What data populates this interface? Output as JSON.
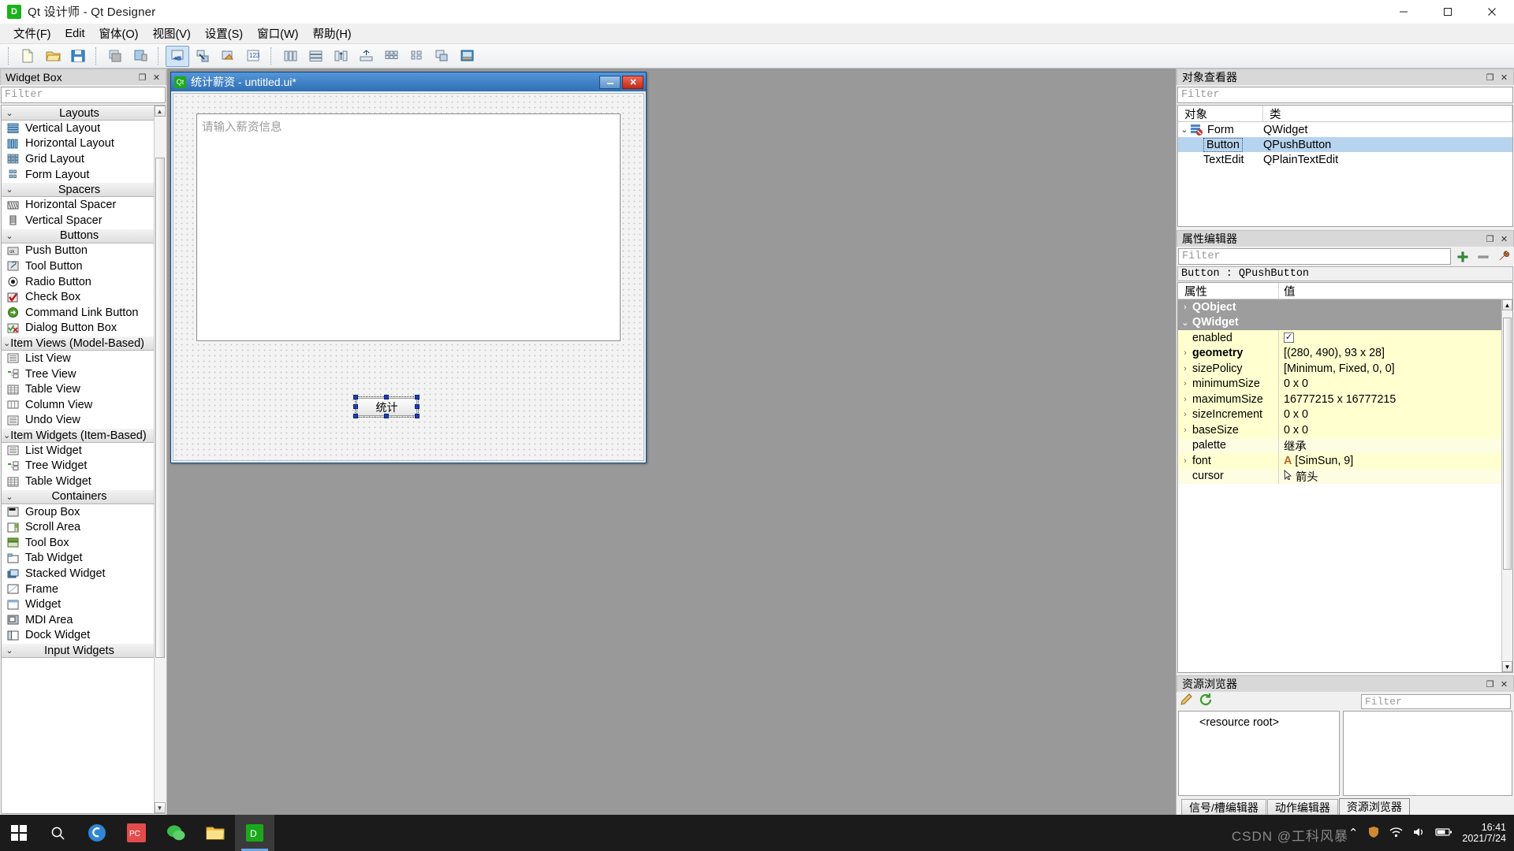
{
  "window": {
    "app_icon": "D",
    "title": "Qt 设计师 - Qt Designer",
    "minimize": "—",
    "maximize": "▢",
    "close": "✕"
  },
  "menubar": {
    "items": [
      {
        "label": "文件(F)"
      },
      {
        "label": "Edit"
      },
      {
        "label": "窗体(O)"
      },
      {
        "label": "视图(V)"
      },
      {
        "label": "设置(S)"
      },
      {
        "label": "窗口(W)"
      },
      {
        "label": "帮助(H)"
      }
    ]
  },
  "toolbar": {
    "groups": [
      {
        "buttons": [
          {
            "name": "new-form-button",
            "icon": "new-file-icon"
          },
          {
            "name": "open-form-button",
            "icon": "open-folder-icon"
          },
          {
            "name": "save-form-button",
            "icon": "save-disk-icon"
          }
        ]
      },
      {
        "buttons": [
          {
            "name": "undo-button",
            "icon": "undo-icon"
          },
          {
            "name": "redo-button",
            "icon": "redo-icon"
          }
        ]
      },
      {
        "buttons": [
          {
            "name": "edit-widgets-button",
            "icon": "edit-widgets-icon",
            "active": true
          },
          {
            "name": "edit-signals-slots-button",
            "icon": "signals-slots-icon"
          },
          {
            "name": "edit-buddies-button",
            "icon": "buddies-icon"
          },
          {
            "name": "edit-tab-order-button",
            "icon": "tab-order-icon"
          }
        ]
      },
      {
        "buttons": [
          {
            "name": "layout-horizontally-button",
            "icon": "layout-horizontal-icon"
          },
          {
            "name": "layout-vertically-button",
            "icon": "layout-vertical-icon"
          },
          {
            "name": "layout-splitter-horizontal-button",
            "icon": "splitter-h-icon"
          },
          {
            "name": "layout-splitter-vertical-button",
            "icon": "splitter-v-icon"
          },
          {
            "name": "layout-grid-button",
            "icon": "layout-grid-icon"
          },
          {
            "name": "layout-form-button",
            "icon": "layout-form-icon"
          },
          {
            "name": "break-layout-button",
            "icon": "break-layout-icon"
          },
          {
            "name": "adjust-size-button",
            "icon": "adjust-size-icon"
          }
        ]
      }
    ]
  },
  "widget_box": {
    "title": "Widget Box",
    "filter_placeholder": "Filter",
    "float_btn": "❐",
    "close_btn": "✕",
    "groups": [
      {
        "name": "Layouts",
        "chevron": "⌄",
        "items": [
          {
            "label": "Vertical Layout",
            "icon": "vertical-layout-icon"
          },
          {
            "label": "Horizontal Layout",
            "icon": "horizontal-layout-icon"
          },
          {
            "label": "Grid Layout",
            "icon": "grid-layout-icon"
          },
          {
            "label": "Form Layout",
            "icon": "form-layout-icon"
          }
        ]
      },
      {
        "name": "Spacers",
        "chevron": "⌄",
        "items": [
          {
            "label": "Horizontal Spacer",
            "icon": "horizontal-spacer-icon"
          },
          {
            "label": "Vertical Spacer",
            "icon": "vertical-spacer-icon"
          }
        ]
      },
      {
        "name": "Buttons",
        "chevron": "⌄",
        "items": [
          {
            "label": "Push Button",
            "icon": "push-button-icon"
          },
          {
            "label": "Tool Button",
            "icon": "tool-button-icon"
          },
          {
            "label": "Radio Button",
            "icon": "radio-button-icon"
          },
          {
            "label": "Check Box",
            "icon": "check-box-icon"
          },
          {
            "label": "Command Link Button",
            "icon": "command-link-icon"
          },
          {
            "label": "Dialog Button Box",
            "icon": "dialog-button-box-icon"
          }
        ]
      },
      {
        "name": "Item Views (Model-Based)",
        "chevron": "⌄",
        "items": [
          {
            "label": "List View",
            "icon": "list-view-icon"
          },
          {
            "label": "Tree View",
            "icon": "tree-view-icon"
          },
          {
            "label": "Table View",
            "icon": "table-view-icon"
          },
          {
            "label": "Column View",
            "icon": "column-view-icon"
          },
          {
            "label": "Undo View",
            "icon": "undo-view-icon"
          }
        ]
      },
      {
        "name": "Item Widgets (Item-Based)",
        "chevron": "⌄",
        "items": [
          {
            "label": "List Widget",
            "icon": "list-widget-icon"
          },
          {
            "label": "Tree Widget",
            "icon": "tree-widget-icon"
          },
          {
            "label": "Table Widget",
            "icon": "table-widget-icon"
          }
        ]
      },
      {
        "name": "Containers",
        "chevron": "⌄",
        "items": [
          {
            "label": "Group Box",
            "icon": "group-box-icon"
          },
          {
            "label": "Scroll Area",
            "icon": "scroll-area-icon"
          },
          {
            "label": "Tool Box",
            "icon": "tool-box-icon"
          },
          {
            "label": "Tab Widget",
            "icon": "tab-widget-icon"
          },
          {
            "label": "Stacked Widget",
            "icon": "stacked-widget-icon"
          },
          {
            "label": "Frame",
            "icon": "frame-icon"
          },
          {
            "label": "Widget",
            "icon": "widget-icon"
          },
          {
            "label": "MDI Area",
            "icon": "mdi-area-icon"
          },
          {
            "label": "Dock Widget",
            "icon": "dock-widget-icon"
          }
        ]
      },
      {
        "name": "Input Widgets",
        "chevron": "⌄",
        "items": []
      }
    ]
  },
  "form_window": {
    "icon_text": "Qt",
    "title": "统计薪资 - untitled.ui*",
    "minimize": "—",
    "close": "✕",
    "plain_text_edit": {
      "placeholder": "请输入薪资信息"
    },
    "push_button": {
      "label": "统计"
    }
  },
  "object_inspector": {
    "title": "对象查看器",
    "filter_placeholder": "Filter",
    "float_btn": "❐",
    "close_btn": "✕",
    "columns": [
      "对象",
      "类"
    ],
    "rows": [
      {
        "object": "Form",
        "class": "QWidget",
        "level": 0,
        "chevron": "⌄",
        "selected": false
      },
      {
        "object": "Button",
        "class": "QPushButton",
        "level": 1,
        "chevron": "",
        "selected": true
      },
      {
        "object": "TextEdit",
        "class": "QPlainTextEdit",
        "level": 1,
        "chevron": "",
        "selected": false
      }
    ]
  },
  "property_editor": {
    "title": "属性编辑器",
    "filter_placeholder": "Filter",
    "float_btn": "❐",
    "close_btn": "✕",
    "add_icon": "plus-icon",
    "remove_icon": "minus-icon",
    "config_icon": "wrench-icon",
    "selection": "Button : QPushButton",
    "columns": [
      "属性",
      "值"
    ],
    "rows": [
      {
        "name": "QObject",
        "value": "",
        "type": "group",
        "expander": "›"
      },
      {
        "name": "QWidget",
        "value": "",
        "type": "group",
        "expander": "⌄"
      },
      {
        "name": "enabled",
        "value": "",
        "type": "checkbox",
        "expander": "",
        "checked": "✓"
      },
      {
        "name": "geometry",
        "value": "[(280, 490), 93 x 28]",
        "type": "bold",
        "expander": "›"
      },
      {
        "name": "sizePolicy",
        "value": "[Minimum, Fixed, 0, 0]",
        "type": "normal",
        "expander": "›"
      },
      {
        "name": "minimumSize",
        "value": "0 x 0",
        "type": "normal",
        "expander": "›"
      },
      {
        "name": "maximumSize",
        "value": "16777215 x 16777215",
        "type": "normal",
        "expander": "›"
      },
      {
        "name": "sizeIncrement",
        "value": "0 x 0",
        "type": "normal",
        "expander": "›"
      },
      {
        "name": "baseSize",
        "value": "0 x 0",
        "type": "normal",
        "expander": "›"
      },
      {
        "name": "palette",
        "value": "继承",
        "type": "normal",
        "expander": ""
      },
      {
        "name": "font",
        "value": "[SimSun, 9]",
        "type": "font",
        "expander": "›"
      },
      {
        "name": "cursor",
        "value": "箭头",
        "type": "cursor",
        "expander": ""
      }
    ]
  },
  "resource_browser": {
    "title": "资源浏览器",
    "float_btn": "❐",
    "close_btn": "✕",
    "edit_icon": "pencil-icon",
    "reload_icon": "refresh-icon",
    "filter_placeholder": "Filter",
    "root_label": "<resource root>",
    "tabs": [
      {
        "label": "信号/槽编辑器",
        "active": false
      },
      {
        "label": "动作编辑器",
        "active": false
      },
      {
        "label": "资源浏览器",
        "active": true
      }
    ]
  },
  "taskbar": {
    "start_icon": "windows-logo-icon",
    "search_icon": "search-icon",
    "apps": [
      {
        "name": "sogou-input-icon",
        "label": "S",
        "color": "#2f86d6",
        "active": false
      },
      {
        "name": "pycharm-icon",
        "label": "PC",
        "color": "#e34c4c",
        "active": false
      },
      {
        "name": "wechat-icon",
        "label": "",
        "color": "#3bbd4a",
        "active": false
      },
      {
        "name": "file-explorer-icon",
        "label": "",
        "color": "#f0c14b",
        "active": false
      },
      {
        "name": "qt-designer-icon",
        "label": "D",
        "color": "#1ca81c",
        "active": true
      }
    ],
    "tray": {
      "chevron": "⌃",
      "icons": [
        "shield-icon",
        "network-icon",
        "volume-icon",
        "battery-icon"
      ],
      "time": "16:41",
      "date": "2021/7/24"
    },
    "watermark": "CSDN @工科风暴"
  }
}
